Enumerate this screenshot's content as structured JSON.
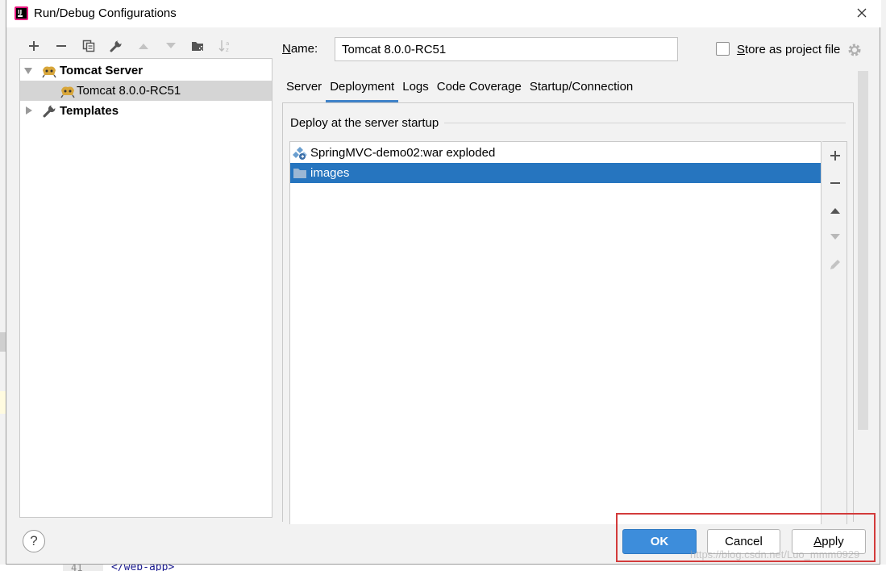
{
  "window": {
    "title": "Run/Debug Configurations"
  },
  "tree": {
    "items": [
      {
        "label": "Tomcat Server",
        "bold": true
      },
      {
        "label": "Tomcat 8.0.0-RC51",
        "selected": true
      },
      {
        "label": "Templates",
        "bold": true
      }
    ]
  },
  "config": {
    "name_label": "Name:",
    "name_mnemonic": "N",
    "name_rest": "ame:",
    "name_value": "Tomcat 8.0.0-RC51",
    "store_label_mnemonic": "S",
    "store_label_rest": "tore as project file",
    "store_checked": false
  },
  "tabs": [
    {
      "label": "Server"
    },
    {
      "label": "Deployment",
      "active": true
    },
    {
      "label": "Logs"
    },
    {
      "label": "Code Coverage"
    },
    {
      "label": "Startup/Connection"
    }
  ],
  "deployment": {
    "caption": "Deploy at the server startup",
    "items": [
      {
        "label": "SpringMVC-demo02:war exploded",
        "icon": "artifact-icon"
      },
      {
        "label": "images",
        "icon": "folder-icon",
        "selected": true
      }
    ]
  },
  "buttons": {
    "help": "?",
    "ok": "OK",
    "cancel": "Cancel",
    "apply_mnemonic": "A",
    "apply_rest": "pply"
  },
  "background": {
    "line_number": "41",
    "code": "</web-app>",
    "watermark": "https://blog.csdn.net/Luo_mmm0929"
  },
  "colors": {
    "accent": "#4083c9",
    "selection": "#2675bf",
    "ok_button": "#3d8ddb",
    "highlight_box": "#d33b3b"
  }
}
